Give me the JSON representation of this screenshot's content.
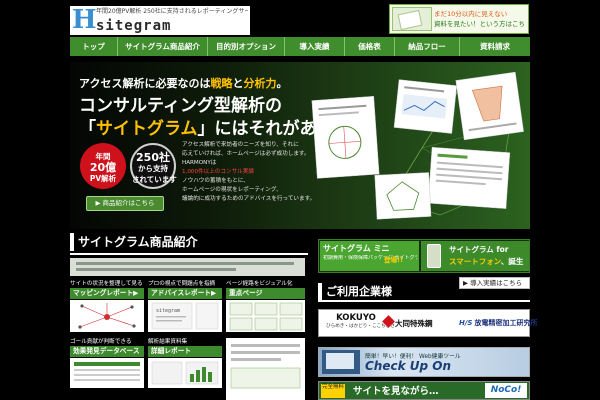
{
  "header": {
    "logo_letter": "H",
    "logo_word": "sitegram",
    "tagline": "年間20億PV解析 250社に支持されるレポーティングサービス",
    "promo_line1": "まだ10分以内に見えない",
    "promo_line2": "資料を見たい！という方はこちら"
  },
  "nav": {
    "items": [
      {
        "label": "トップ"
      },
      {
        "label": "サイトグラム商品紹介"
      },
      {
        "label": "目的別オプション"
      },
      {
        "label": "導入実績"
      },
      {
        "label": "価格表"
      },
      {
        "label": "納品フロー"
      },
      {
        "label": "資料請求"
      }
    ]
  },
  "hero": {
    "line1_a": "アクセス解析に必要なのは",
    "line1_b": "戦略",
    "line1_c": "と",
    "line1_d": "分析力",
    "line1_e": "。",
    "line2": "コンサルティング型解析の",
    "line3_a": "「",
    "line3_b": "サイトグラム",
    "line3_c": "」にはそれがある。",
    "badge1_top": "年間",
    "badge1_big": "20億",
    "badge1_bottom": "PV解析",
    "badge2_big": "250社",
    "badge2_mid": "から支持",
    "badge2_bottom": "されています",
    "desc": [
      "アクセス解析で来訪者のニーズを知り、それに",
      "応えていければ、ホームページは必ず成功します。",
      "HARMONYは",
      "ノウハウの蓄積をもとに、",
      "ホームページの現状をレポーティング、",
      "議論的に成功するためのアドバイスを行っています。"
    ],
    "desc_red": "1,000件以上のコンサル実績",
    "button": "▶ 商品紹介はこちら"
  },
  "products": {
    "title": "サイトグラム商品紹介",
    "cards": [
      {
        "caption": "サイトの状況を整理して見る",
        "title": "マッピングレポート▶"
      },
      {
        "caption": "プロの視点で問題点を指摘",
        "title": "アドバイスレポート▶"
      },
      {
        "caption": "ページ経路をビジュアル化",
        "title": "重点ページ"
      },
      {
        "caption": "ゴール貢献が判断できる",
        "title": "効果発見データベース"
      },
      {
        "caption": "解析結果資料集",
        "title": "詳細レポート"
      }
    ],
    "thumb_label": "sitegram"
  },
  "promo_right": {
    "left_title": "サイトグラム ミニ",
    "left_sub": "初期費用・保険保障パッケージ サイトグラム ミニ",
    "left_tag": "登場!!",
    "right_line1": "サイトグラム for",
    "right_line2_a": "スマートフォン",
    "right_line2_b": "、誕生"
  },
  "clients": {
    "link": "▶ 導入実績はこちら",
    "title": "ご利用企業様",
    "kokuyo": "KOKUYO",
    "kokuyo_sub": "ひらめき・はかどり・ここちよさ",
    "daido": "大同特殊鋼",
    "hs_mark": "H/S",
    "hs_name": "放電精密加工研究所"
  },
  "checkup": {
    "line1": "簡単！早い！便利！ Web健康ツール",
    "title": "Check Up On"
  },
  "noco": {
    "tag": "完全無料",
    "text": "サイトを見ながら…",
    "logo": "NoCo!"
  }
}
